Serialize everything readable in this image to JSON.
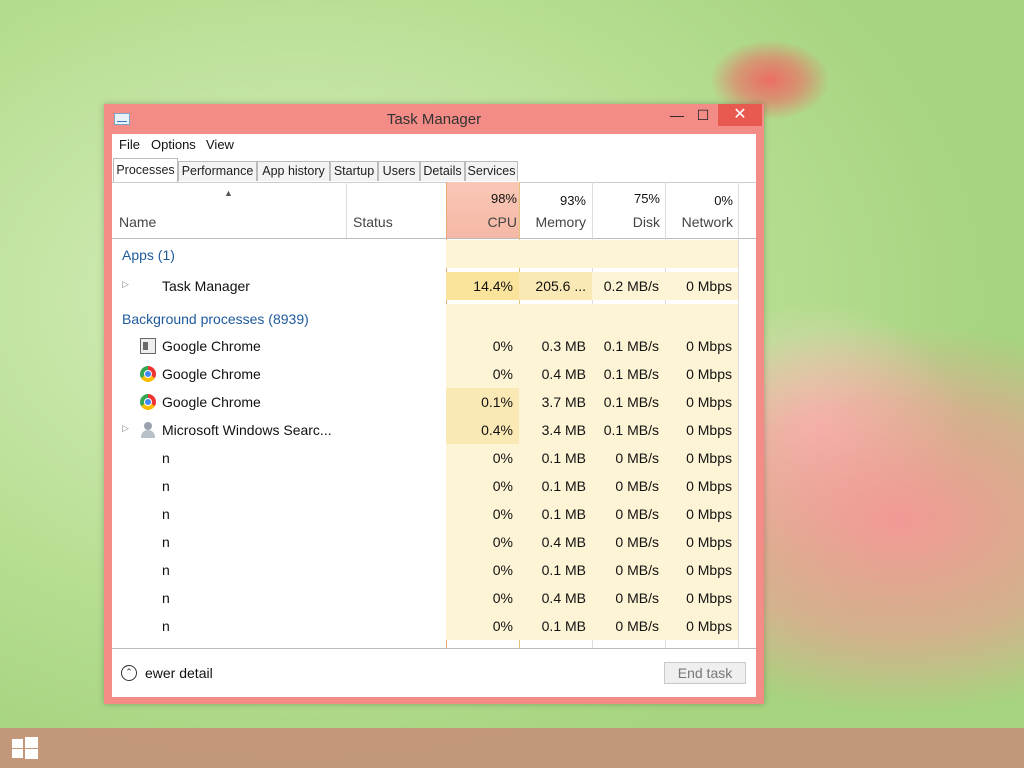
{
  "window": {
    "title": "Task Manager",
    "minimize": "—",
    "maximize": "☐",
    "close": "✕"
  },
  "menu": [
    "File",
    "Options",
    "View"
  ],
  "tabs": [
    "Processes",
    "Performance",
    "App history",
    "Startup",
    "Users",
    "Details",
    "Services"
  ],
  "columns": {
    "name": "Name",
    "status": "Status",
    "cpu": {
      "label": "CPU",
      "pct": "98%"
    },
    "memory": {
      "label": "Memory",
      "pct": "93%"
    },
    "disk": {
      "label": "Disk",
      "pct": "75%"
    },
    "network": {
      "label": "Network",
      "pct": "0%"
    }
  },
  "groups": {
    "apps": "Apps (1)",
    "background": "Background processes (8939)"
  },
  "apps": [
    {
      "name": "Task Manager",
      "cpu": "14.4%",
      "memory": "205.6 ...",
      "disk": "0.2 MB/s",
      "network": "0 Mbps",
      "icon": "task-manager-icon"
    }
  ],
  "background": [
    {
      "name": "Google Chrome",
      "cpu": "0%",
      "memory": "0.3 MB",
      "disk": "0.1 MB/s",
      "network": "0 Mbps",
      "icon": "window-icon"
    },
    {
      "name": "Google Chrome",
      "cpu": "0%",
      "memory": "0.4 MB",
      "disk": "0.1 MB/s",
      "network": "0 Mbps",
      "icon": "chrome-icon"
    },
    {
      "name": "Google Chrome",
      "cpu": "0.1%",
      "memory": "3.7 MB",
      "disk": "0.1 MB/s",
      "network": "0 Mbps",
      "icon": "chrome-icon"
    },
    {
      "name": "Microsoft Windows Searc...",
      "cpu": "0.4%",
      "memory": "3.4 MB",
      "disk": "0.1 MB/s",
      "network": "0 Mbps",
      "icon": "user-icon"
    },
    {
      "name": "n",
      "cpu": "0%",
      "memory": "0.1 MB",
      "disk": "0 MB/s",
      "network": "0 Mbps"
    },
    {
      "name": "n",
      "cpu": "0%",
      "memory": "0.1 MB",
      "disk": "0 MB/s",
      "network": "0 Mbps"
    },
    {
      "name": "n",
      "cpu": "0%",
      "memory": "0.1 MB",
      "disk": "0 MB/s",
      "network": "0 Mbps"
    },
    {
      "name": "n",
      "cpu": "0%",
      "memory": "0.4 MB",
      "disk": "0 MB/s",
      "network": "0 Mbps"
    },
    {
      "name": "n",
      "cpu": "0%",
      "memory": "0.1 MB",
      "disk": "0 MB/s",
      "network": "0 Mbps"
    },
    {
      "name": "n",
      "cpu": "0%",
      "memory": "0.4 MB",
      "disk": "0 MB/s",
      "network": "0 Mbps"
    },
    {
      "name": "n",
      "cpu": "0%",
      "memory": "0.1 MB",
      "disk": "0 MB/s",
      "network": "0 Mbps"
    }
  ],
  "footer": {
    "fewer_details": "ewer detail",
    "end_task": "End task"
  },
  "colors": {
    "window_frame": "#f38b86",
    "close_button": "#e85a4f",
    "group_text": "#1e5a9c",
    "heat_light": "#fdf4d6",
    "heat_medium": "#fbe9b5",
    "heat_strong": "#f9dd9a"
  }
}
